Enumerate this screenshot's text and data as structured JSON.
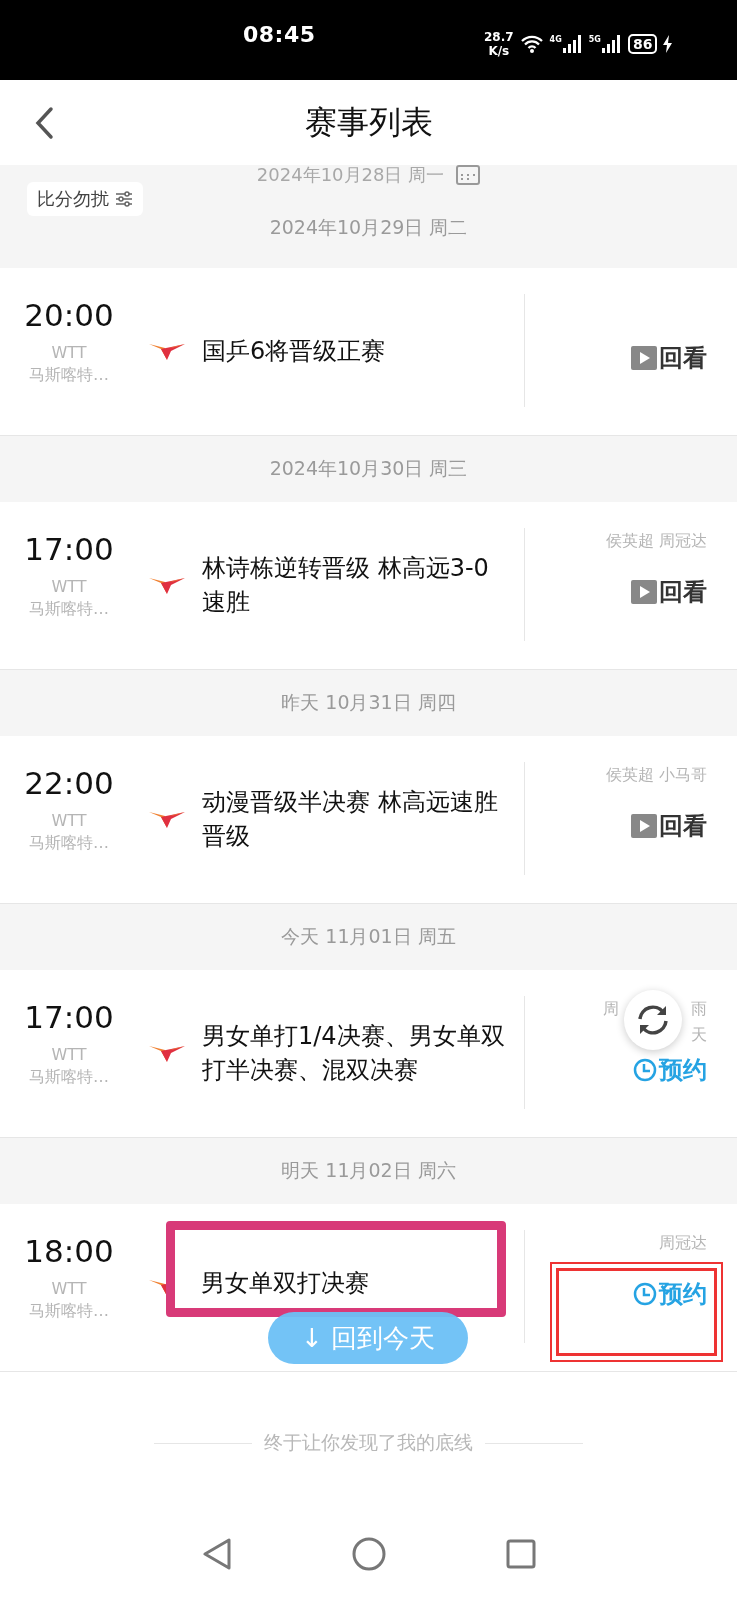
{
  "status_bar": {
    "time": "08:45",
    "speed": "28.7",
    "speed_unit": "K/s",
    "network_1": "4G",
    "network_2": "5G",
    "battery": "86"
  },
  "header": {
    "title": "赛事列表"
  },
  "calendar_date": "2024年10月28日 周一",
  "mute_button": "比分勿扰",
  "days": [
    {
      "date": "2024年10月29日 周二",
      "matches": [
        {
          "time": "20:00",
          "org": "WTT",
          "venue": "马斯喀特…",
          "title": "国乒6将晋级正赛",
          "action": {
            "kind": "replay",
            "label": "回看"
          }
        }
      ]
    },
    {
      "date": "2024年10月30日 周三",
      "matches": [
        {
          "time": "17:00",
          "org": "WTT",
          "venue": "马斯喀特…",
          "title": "林诗栋逆转晋级 林高远3-0速胜",
          "commentators": "侯英超 周冠达",
          "action": {
            "kind": "replay",
            "label": "回看"
          }
        }
      ]
    },
    {
      "date": "昨天 10月31日 周四",
      "matches": [
        {
          "time": "22:00",
          "org": "WTT",
          "venue": "马斯喀特…",
          "title": "动漫晋级半决赛 林高远速胜晋级",
          "commentators": "侯英超 小马哥",
          "action": {
            "kind": "replay",
            "label": "回看"
          }
        }
      ]
    },
    {
      "date": "今天 11月01日 周五",
      "matches": [
        {
          "time": "17:00",
          "org": "WTT",
          "venue": "马斯喀特…",
          "title": "男女单打1/4决赛、男女单双打半决赛、混双决赛",
          "commentator_fragments": [
            "周",
            "雨",
            "天"
          ],
          "action": {
            "kind": "reserve",
            "label": "预约"
          },
          "refresh_overlay": true
        }
      ]
    },
    {
      "date": "明天 11月02日 周六",
      "matches": [
        {
          "time": "18:00",
          "org": "WTT",
          "venue": "马斯喀特…",
          "title": "男女单双打决赛",
          "commentators": "周冠达",
          "action": {
            "kind": "reserve",
            "label": "预约"
          },
          "highlight_title": true,
          "highlight_action": true,
          "back_to_today": {
            "arrow": "↓",
            "label": "回到今天"
          }
        }
      ]
    }
  ],
  "footer": "终于让你发现了我的底线"
}
